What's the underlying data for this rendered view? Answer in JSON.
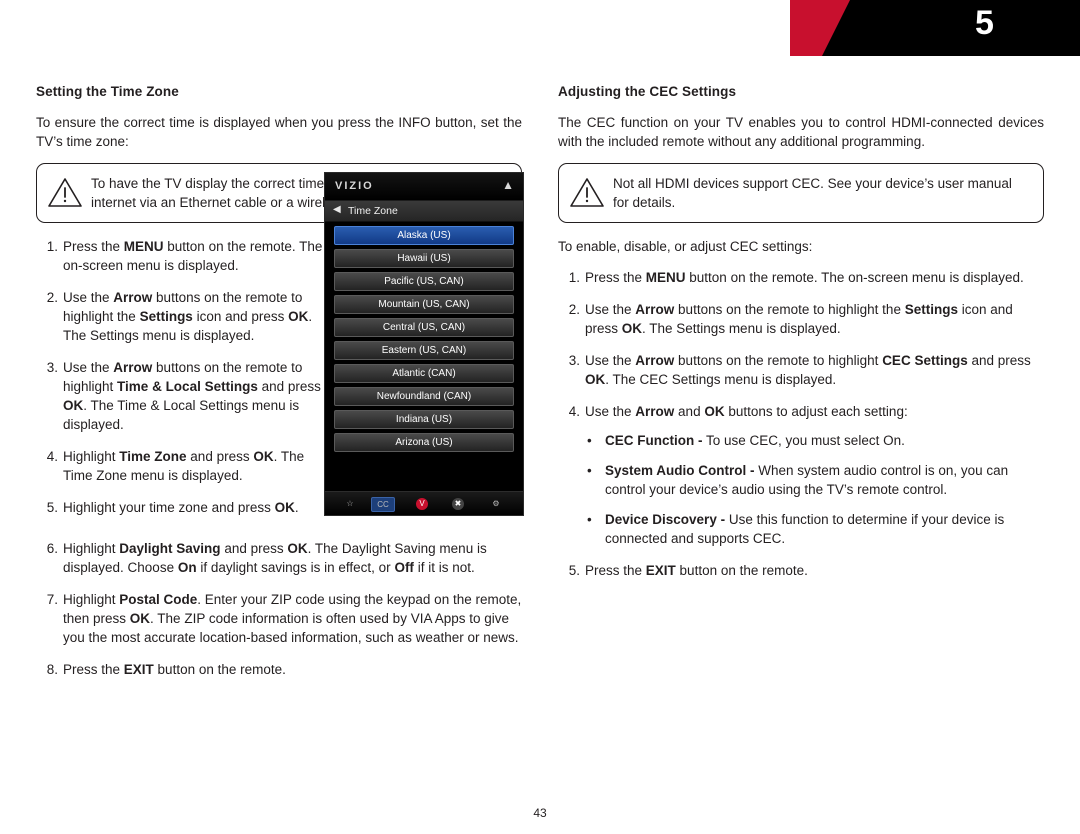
{
  "header": {
    "chapter_number": "5",
    "band_red": "#c8102e",
    "band_black": "#000000"
  },
  "left_column": {
    "title": "Setting the Time Zone",
    "intro": "To ensure the correct time is displayed when you press the INFO button, set the TV’s time zone:",
    "note": "To have the TV display the correct time, you must be connected to the internet via an Ethernet cable or a wireless network.",
    "note_icon": "warning-triangle-icon",
    "steps": [
      {
        "num": "1.",
        "html": "Press the <b>MENU</b> button on the remote. The on-screen menu is displayed."
      },
      {
        "num": "2.",
        "html": "Use the <b>Arrow</b> buttons on the remote to highlight the <b>Settings</b> icon and press <b>OK</b>. The Settings menu is displayed."
      },
      {
        "num": "3.",
        "html": "Use the <b>Arrow</b> buttons on the remote to highlight <b>Time &amp; Local Settings</b> and press <b>OK</b>. The Time &amp; Local Settings menu is displayed."
      },
      {
        "num": "4.",
        "html": "Highlight <b>Time Zone</b> and press <b>OK</b>. The Time Zone menu is displayed."
      },
      {
        "num": "5.",
        "html": "Highlight your time zone and press <b>OK</b>."
      },
      {
        "num": "6.",
        "html": "Highlight <b>Daylight Saving</b> and press <b>OK</b>. The Daylight Saving menu is displayed. Choose <b>On</b> if daylight savings is in effect, or <b>Off</b> if it is not."
      },
      {
        "num": "7.",
        "html": "Highlight <b>Postal Code</b>. Enter your ZIP code using the keypad on the remote, then press <b>OK</b>. The ZIP code information is often used by VIA Apps to give you the most accurate location-based information, such as weather or news."
      },
      {
        "num": "8.",
        "html": "Press the <b>EXIT</b> button on the remote."
      }
    ]
  },
  "tv_screenshot": {
    "logo": "VIZIO",
    "home_icon": "home-icon",
    "back_icon": "back-arrow-icon",
    "menu_title": "Time Zone",
    "items": [
      {
        "label": "Alaska (US)",
        "selected": true
      },
      {
        "label": "Hawaii (US)",
        "selected": false
      },
      {
        "label": "Pacific (US, CAN)",
        "selected": false
      },
      {
        "label": "Mountain (US, CAN)",
        "selected": false
      },
      {
        "label": "Central (US, CAN)",
        "selected": false
      },
      {
        "label": "Eastern (US, CAN)",
        "selected": false
      },
      {
        "label": "Atlantic (CAN)",
        "selected": false
      },
      {
        "label": "Newfoundland (CAN)",
        "selected": false
      },
      {
        "label": "Indiana (US)",
        "selected": false
      },
      {
        "label": "Arizona (US)",
        "selected": false
      }
    ],
    "bottom_icons": [
      "star-icon",
      "cc-icon",
      "vizio-v-icon",
      "close-x-icon",
      "gear-icon"
    ]
  },
  "right_column": {
    "title": "Adjusting the CEC Settings",
    "intro": "The CEC function on your TV enables you to control HDMI-connected devices with the included remote without any additional programming.",
    "note": "Not all HDMI devices support CEC. See your device’s user manual for details.",
    "note_icon": "warning-triangle-icon",
    "lead_in": "To enable, disable, or adjust CEC settings:",
    "steps": [
      {
        "num": "1.",
        "html": "Press the <b>MENU</b> button on the remote. The on-screen menu is displayed."
      },
      {
        "num": "2.",
        "html": "Use the <b>Arrow</b> buttons on the remote to highlight the <b>Settings</b> icon and press <b>OK</b>. The Settings menu is displayed."
      },
      {
        "num": "3.",
        "html": "Use the <b>Arrow</b> buttons on the remote to highlight <b>CEC Settings</b> and press <b>OK</b>. The CEC Settings menu is displayed."
      },
      {
        "num": "4.",
        "html": "Use the <b>Arrow</b> and <b>OK</b> buttons to adjust each setting:"
      }
    ],
    "bullets": [
      {
        "html": "<b>CEC Function -</b> To use CEC, you must select On."
      },
      {
        "html": "<b>System Audio Control -</b> When system audio control is on, you can control your device’s audio using the TV’s remote control."
      },
      {
        "html": "<b>Device Discovery -</b> Use this function to determine if your device is connected and supports CEC."
      }
    ],
    "final_step": {
      "num": "5.",
      "html": "Press the <b>EXIT</b> button on the remote."
    }
  },
  "footer": {
    "page_number": "43"
  }
}
